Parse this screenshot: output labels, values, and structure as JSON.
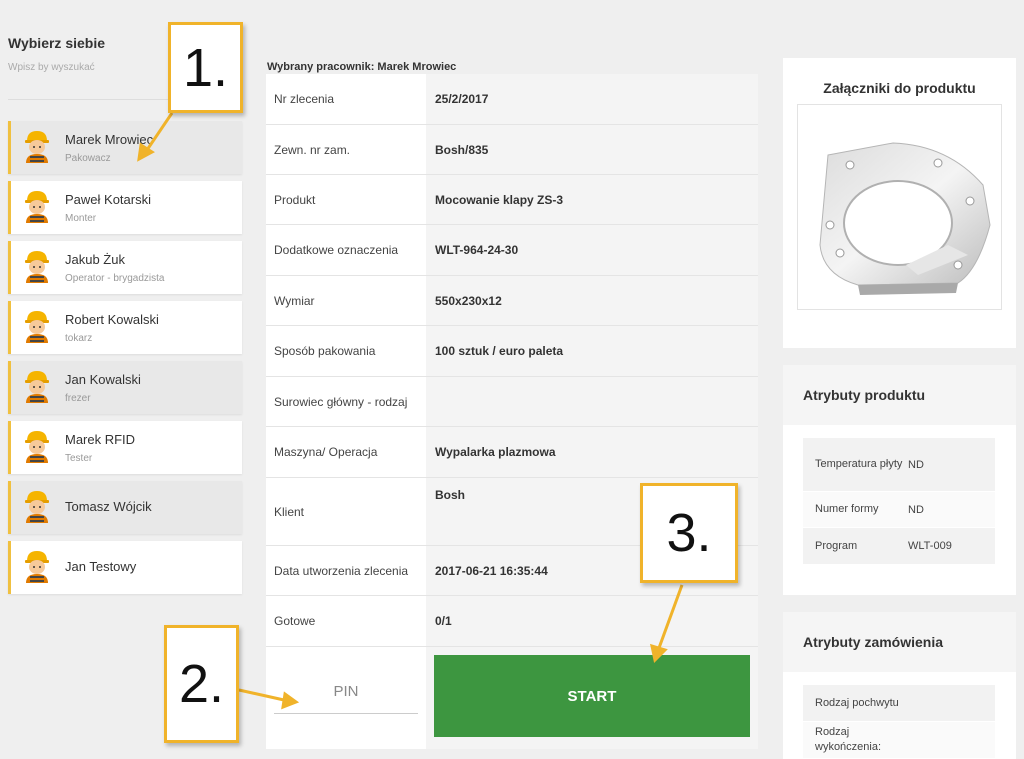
{
  "employee_panel": {
    "title": "Wybierz siebie",
    "search_placeholder": "Wpisz by wyszukać",
    "employees": [
      {
        "name": "Marek Mrowiec",
        "role": "Pakowacz",
        "selected": true
      },
      {
        "name": "Paweł Kotarski",
        "role": "Monter"
      },
      {
        "name": "Jakub Żuk",
        "role": "Operator - brygadzista"
      },
      {
        "name": "Robert Kowalski",
        "role": "tokarz"
      },
      {
        "name": "Jan Kowalski",
        "role": "frezer"
      },
      {
        "name": "Marek RFID",
        "role": "Tester"
      },
      {
        "name": "Tomasz Wójcik",
        "role": ""
      },
      {
        "name": "Jan Testowy",
        "role": ""
      }
    ]
  },
  "order": {
    "selected_worker_label": "Wybrany pracownik: Marek Mrowiec",
    "rows": [
      {
        "label": "Nr zlecenia",
        "value": "25/2/2017"
      },
      {
        "label": "Zewn. nr zam.",
        "value": "Bosh/835"
      },
      {
        "label": "Produkt",
        "value": "Mocowanie klapy ZS-3"
      },
      {
        "label": "Dodatkowe oznaczenia",
        "value": "WLT-964-24-30"
      },
      {
        "label": "Wymiar",
        "value": "550x230x12"
      },
      {
        "label": "Sposób pakowania",
        "value": "100 sztuk / euro paleta"
      },
      {
        "label": "Surowiec główny - rodzaj",
        "value": ""
      },
      {
        "label": "Maszyna/ Operacja",
        "value": "Wypalarka plazmowa"
      },
      {
        "label": "Klient",
        "value": "Bosh"
      },
      {
        "label": "Data utworzenia zlecenia",
        "value": "2017-06-21 16:35:44"
      },
      {
        "label": "Gotowe",
        "value": "0/1"
      }
    ],
    "pin_placeholder": "PIN",
    "start_label": "START"
  },
  "attachments": {
    "title": "Załączniki do produktu"
  },
  "product_attributes": {
    "title": "Atrybuty produktu",
    "rows": [
      {
        "label": "Temperatura płyty",
        "value": "ND"
      },
      {
        "label": "Numer formy",
        "value": "ND"
      },
      {
        "label": "Program",
        "value": "WLT-009"
      }
    ]
  },
  "order_attributes": {
    "title": "Atrybuty zamówienia",
    "rows": [
      {
        "label": "Rodzaj pochwytu",
        "value": ""
      },
      {
        "label": "Rodzaj wykończenia:",
        "value": ""
      }
    ]
  },
  "callouts": [
    "1.",
    "2.",
    "3."
  ],
  "colors": {
    "accent": "#f0b32a",
    "start": "#3d9640",
    "background": "#efefef"
  }
}
